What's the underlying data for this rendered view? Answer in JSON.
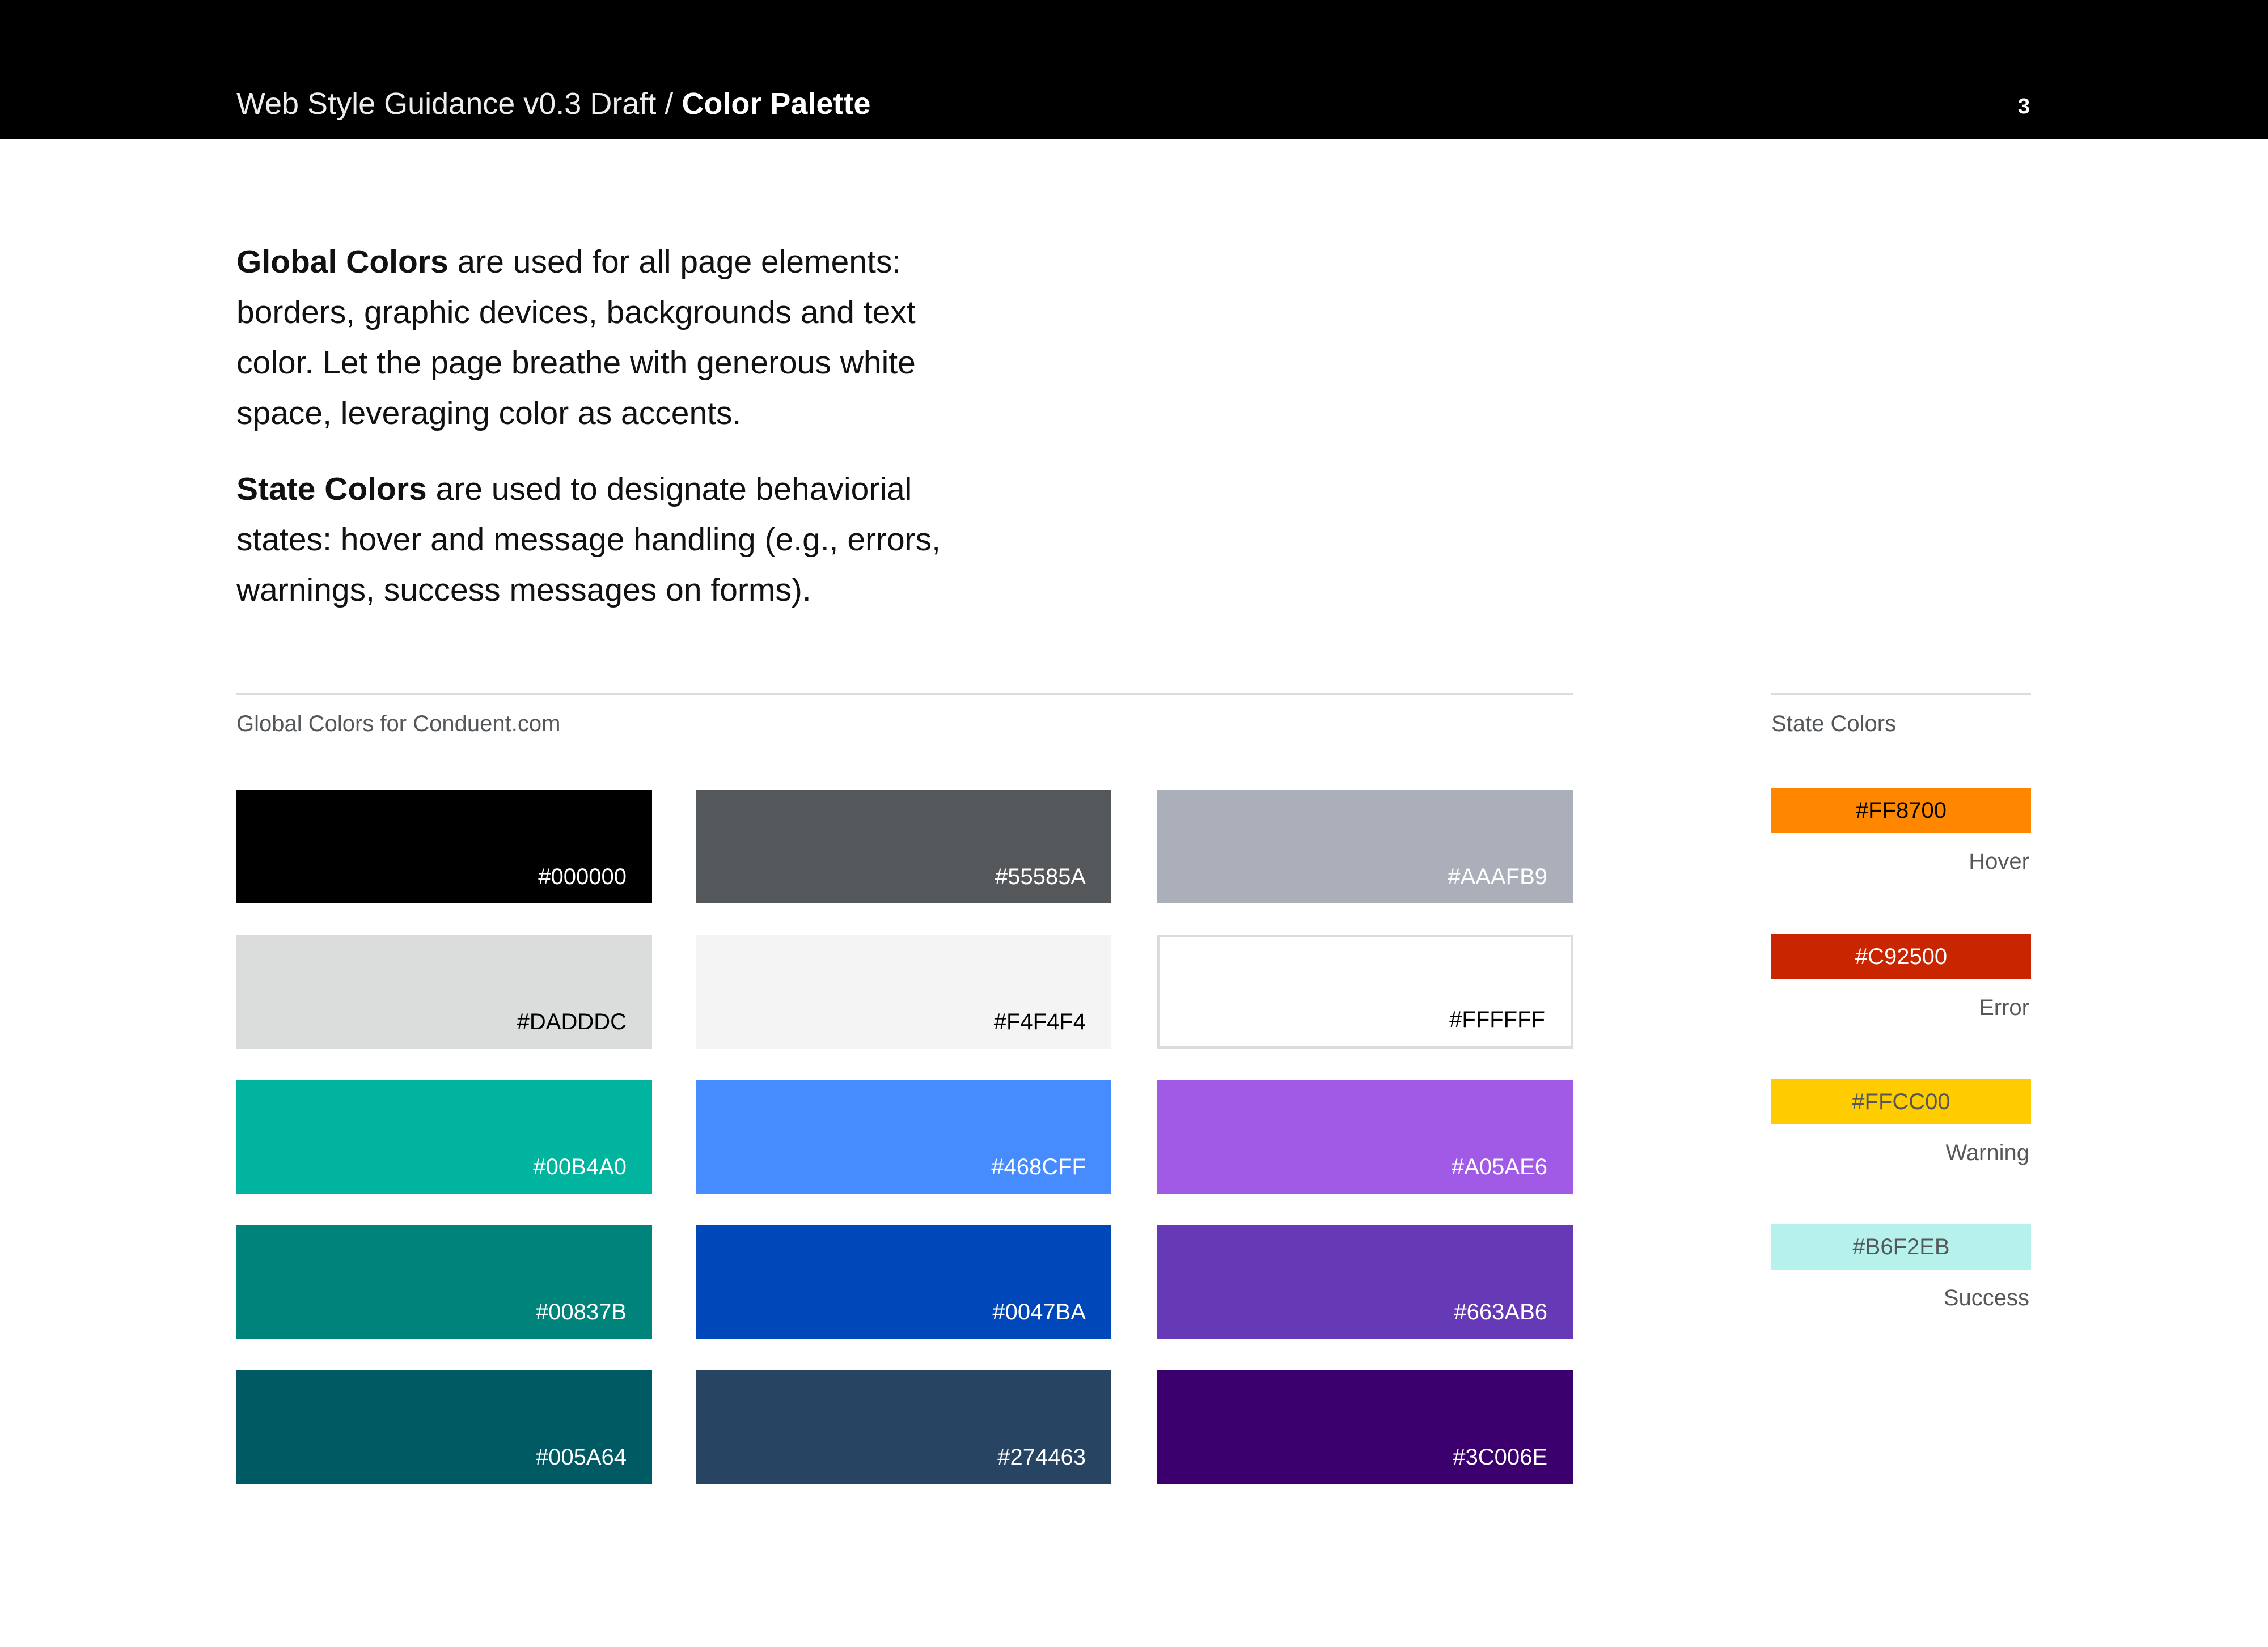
{
  "header": {
    "doc_name": "Web Style Guidance v0.3 Draft",
    "separator": " / ",
    "section": "Color Palette",
    "page_number": "3"
  },
  "intro": {
    "p1_bold": "Global Colors",
    "p1_text": " are used for all page elements: borders, graphic devices, backgrounds and text color. Let the page breathe with generous white space, leveraging color as accents.",
    "p2_bold": "State Colors",
    "p2_text": " are used to designate behaviorial states: hover and message handling (e.g., errors, warnings, success messages on forms)."
  },
  "global": {
    "label": "Global Colors for Conduent.com",
    "swatches": [
      {
        "hex": "#000000",
        "color": "#000000",
        "text_color": "#FFFFFF"
      },
      {
        "hex": "#55585A",
        "color": "#55585A",
        "text_color": "#FFFFFF"
      },
      {
        "hex": "#AAAFB9",
        "color": "#AAAFB9",
        "text_color": "#FFFFFF"
      },
      {
        "hex": "#DADDDC",
        "color": "#DADDDC",
        "text_color": "#000000"
      },
      {
        "hex": "#F4F4F4",
        "color": "#F4F4F4",
        "text_color": "#000000"
      },
      {
        "hex": "#FFFFFF",
        "color": "#FFFFFF",
        "text_color": "#000000"
      },
      {
        "hex": "#00B4A0",
        "color": "#00B4A0",
        "text_color": "#FFFFFF"
      },
      {
        "hex": "#468CFF",
        "color": "#468CFF",
        "text_color": "#FFFFFF"
      },
      {
        "hex": "#A05AE6",
        "color": "#A05AE6",
        "text_color": "#FFFFFF"
      },
      {
        "hex": "#00837B",
        "color": "#00837B",
        "text_color": "#FFFFFF"
      },
      {
        "hex": "#0047BA",
        "color": "#0047BA",
        "text_color": "#FFFFFF"
      },
      {
        "hex": "#663AB6",
        "color": "#663AB6",
        "text_color": "#FFFFFF"
      },
      {
        "hex": "#005A64",
        "color": "#005A64",
        "text_color": "#FFFFFF"
      },
      {
        "hex": "#274463",
        "color": "#274463",
        "text_color": "#FFFFFF"
      },
      {
        "hex": "#3C006E",
        "color": "#3C006E",
        "text_color": "#FFFFFF"
      }
    ]
  },
  "state": {
    "label": "State Colors",
    "swatches": [
      {
        "hex": "#FF8700",
        "color": "#FF8700",
        "text_color": "#000000",
        "name": "Hover"
      },
      {
        "hex": "#C92500",
        "color": "#C92500",
        "text_color": "#FFFFFF",
        "name": "Error"
      },
      {
        "hex": "#FFCC00",
        "color": "#FFCC00",
        "text_color": "#55585A",
        "name": "Warning"
      },
      {
        "hex": "#B6F2EB",
        "color": "#B6F2EB",
        "text_color": "#55585A",
        "name": "Success"
      }
    ]
  }
}
